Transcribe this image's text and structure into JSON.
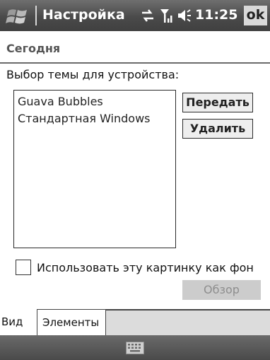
{
  "titlebar": {
    "start_icon": "windows-flag-icon",
    "title": "Настройка",
    "status_icons": [
      "connectivity-icon",
      "signal-icon",
      "volume-icon"
    ],
    "time": "11:25",
    "ok_label": "ok"
  },
  "subheader": {
    "title": "Сегодня"
  },
  "theme_section": {
    "prompt": "Выбор темы для устройства:",
    "themes": [
      "Guava Bubbles",
      "Стандартная Windows"
    ],
    "beam_button": "Передать",
    "delete_button": "Удалить"
  },
  "background_option": {
    "checked": false,
    "label": "Использовать эту картинку как фон",
    "browse_button": "Обзор"
  },
  "tabs": [
    {
      "label": "Вид",
      "active": true
    },
    {
      "label": "Элементы",
      "active": false
    }
  ],
  "menubar": {
    "input_icon": "keyboard-icon"
  },
  "colors": {
    "titlebar": "#4a4a4a",
    "disabled_button": "#cccccc",
    "disabled_text": "#8e8e8e"
  }
}
